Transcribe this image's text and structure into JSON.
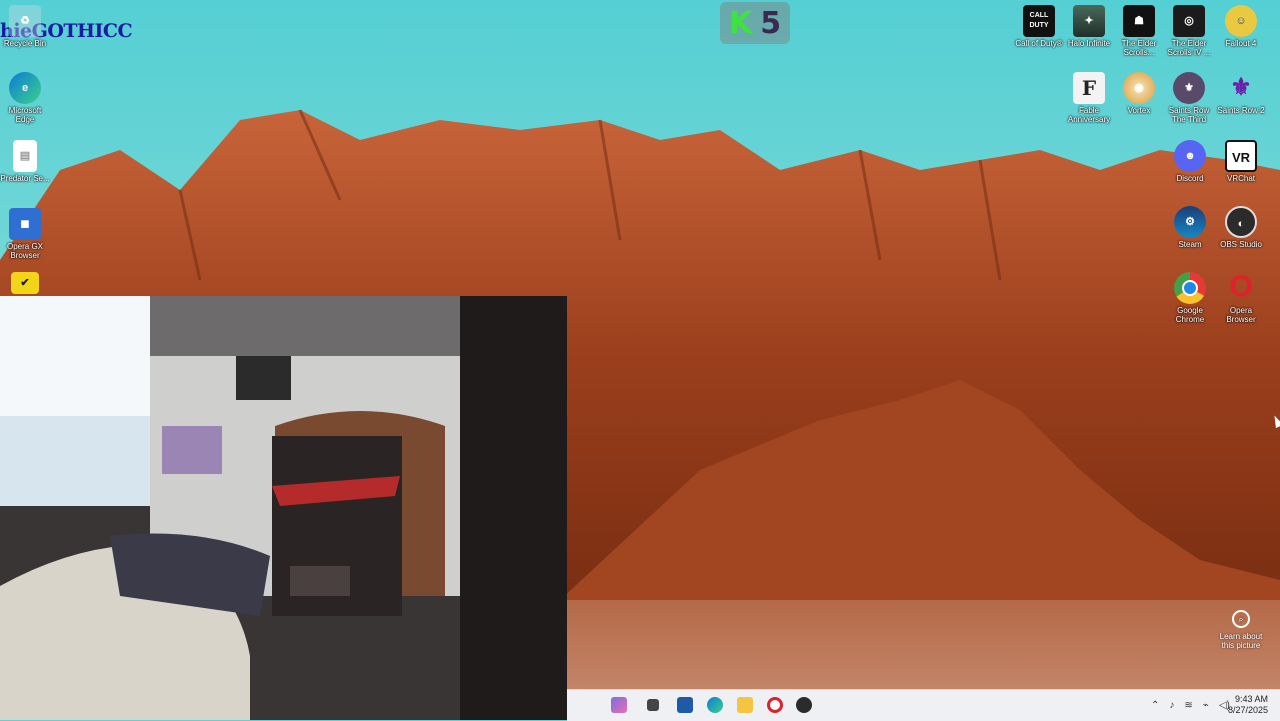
{
  "desktop": {
    "overlay_text": "hieGOTHICC",
    "badge": {
      "left": "K",
      "right": "5"
    },
    "left_icons": [
      {
        "label": "Recycle Bin",
        "icon": "recycle-bin-icon"
      },
      {
        "label": "Microsoft Edge",
        "icon": "edge-icon"
      },
      {
        "label": "Predator Se...",
        "icon": "file-icon"
      },
      {
        "label": "Opera GX Browser",
        "icon": "opera-gx-icon"
      },
      {
        "label": "",
        "icon": "checkmark-app-icon"
      }
    ],
    "right_icons_row1": [
      {
        "label": "Call of Duty®",
        "icon": "call-of-duty-icon"
      },
      {
        "label": "Halo Infinite",
        "icon": "halo-icon"
      },
      {
        "label": "The Elder Scrolls...",
        "icon": "elder-scrolls-icon"
      },
      {
        "label": "The Elder Scrolls IV ...",
        "icon": "oblivion-icon"
      },
      {
        "label": "Fallout 4",
        "icon": "fallout-icon"
      }
    ],
    "right_icons_row2": [
      {
        "label": "Fable Anniversary",
        "icon": "fable-icon"
      },
      {
        "label": "Vortex",
        "icon": "vortex-icon"
      },
      {
        "label": "Saints Row The Third",
        "icon": "saints-row-third-icon"
      },
      {
        "label": "Saints Row 2",
        "icon": "saints-row-2-icon"
      }
    ],
    "right_icons_col": [
      {
        "label": "Discord",
        "icon": "discord-icon"
      },
      {
        "label": "VRChat",
        "icon": "vrchat-icon"
      },
      {
        "label": "Steam",
        "icon": "steam-icon"
      },
      {
        "label": "OBS Studio",
        "icon": "obs-icon"
      },
      {
        "label": "Google Chrome",
        "icon": "chrome-icon"
      },
      {
        "label": "Opera Browser",
        "icon": "opera-icon"
      }
    ],
    "learn": {
      "label": "Learn about this picture"
    }
  },
  "taskbar": {
    "clock_time": "9:43 AM",
    "clock_date": "8/27/2025",
    "apps": [
      "widgets-icon",
      "task-view-icon",
      "terminal-icon",
      "edge-icon",
      "file-explorer-icon",
      "opera-icon",
      "obs-icon"
    ]
  },
  "colors": {
    "sky": "#5ed3d6",
    "rock": "#a64a25",
    "badge_k": "#3fe23f",
    "overlay_text": "#1b1aa4"
  }
}
